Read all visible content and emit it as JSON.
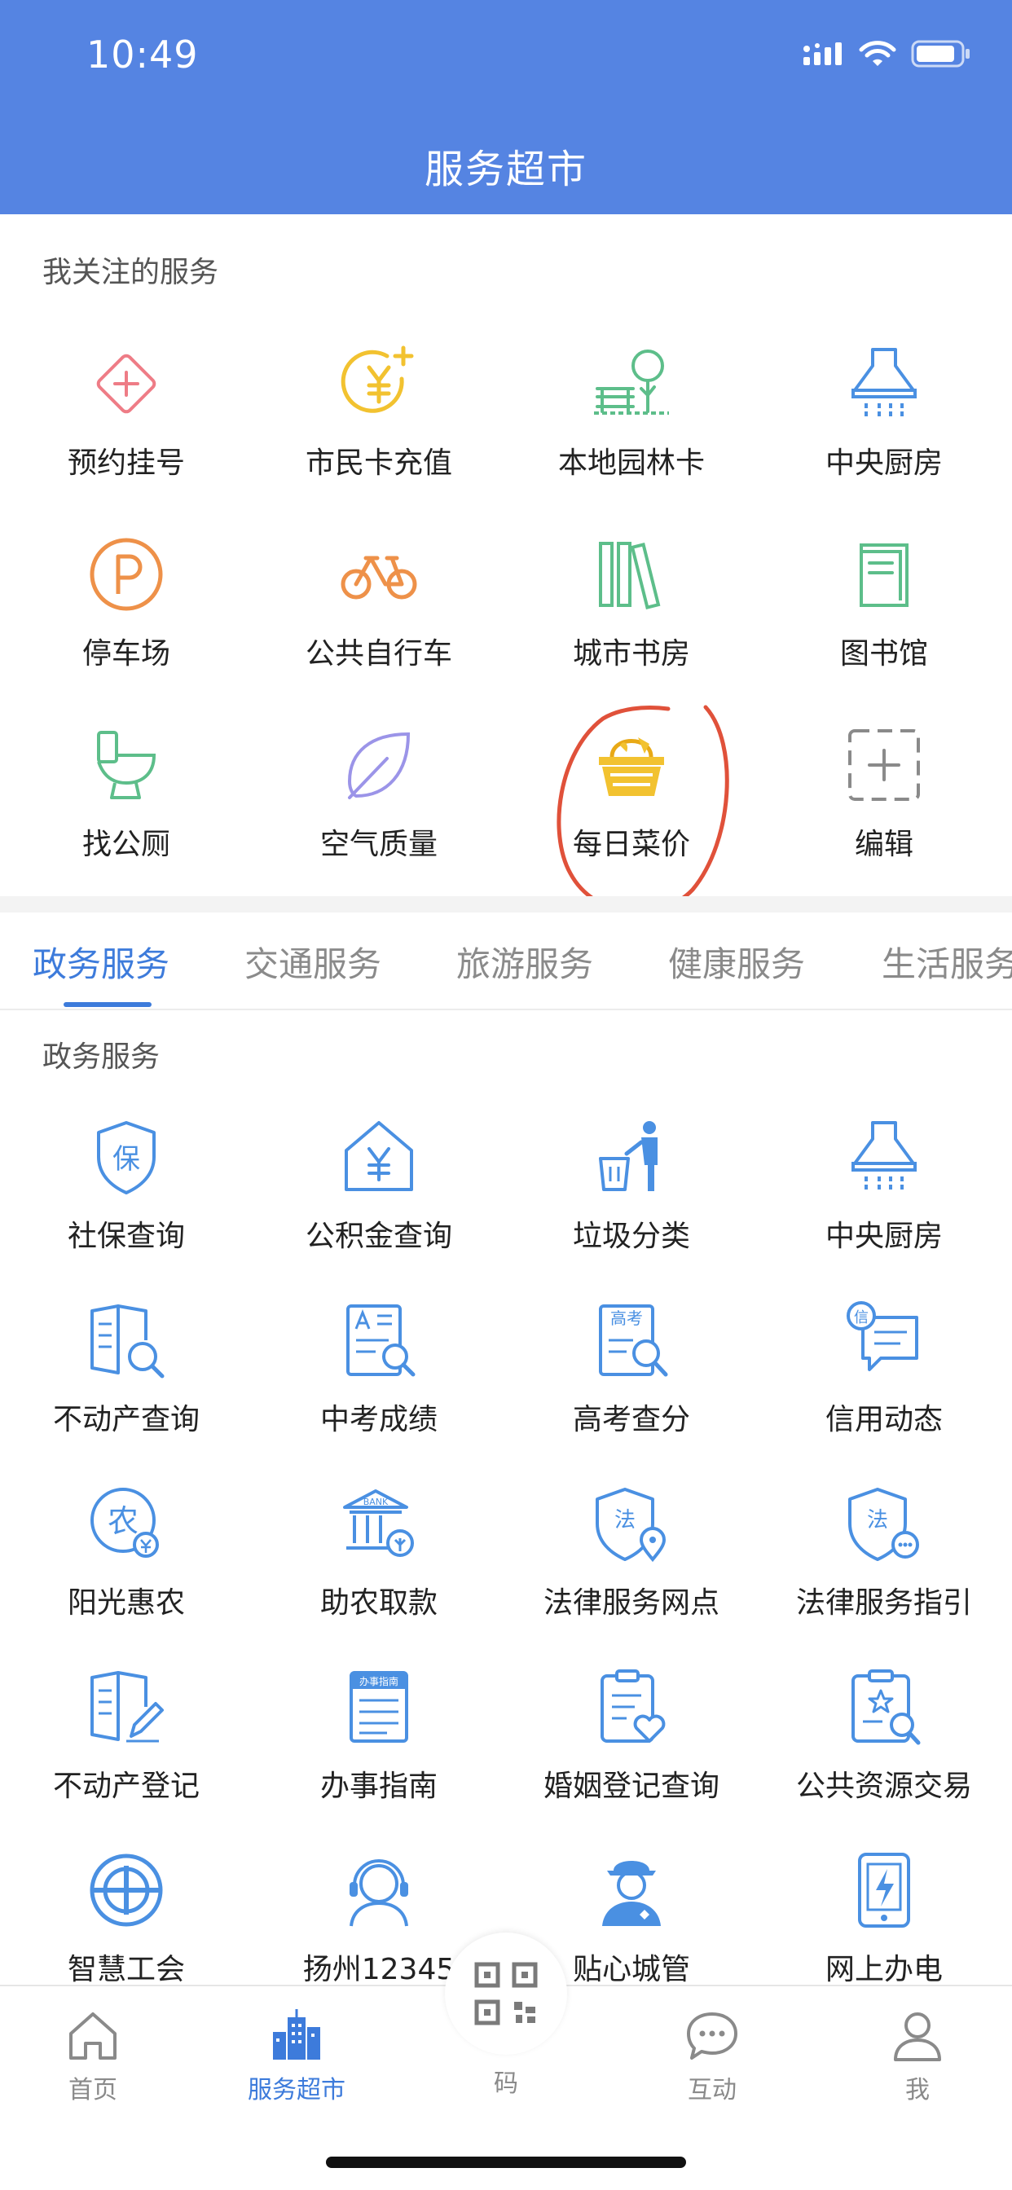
{
  "status_bar": {
    "time": "10:49"
  },
  "header": {
    "title": "服务超市"
  },
  "favorites": {
    "title": "我关注的服务",
    "items": [
      {
        "label": "预约挂号",
        "icon": "hospital-registration-icon"
      },
      {
        "label": "市民卡充值",
        "icon": "yuan-plus-icon"
      },
      {
        "label": "本地园林卡",
        "icon": "park-bench-icon"
      },
      {
        "label": "中央厨房",
        "icon": "range-hood-icon"
      },
      {
        "label": "停车场",
        "icon": "parking-icon"
      },
      {
        "label": "公共自行车",
        "icon": "bicycle-icon"
      },
      {
        "label": "城市书房",
        "icon": "bookshelf-icon"
      },
      {
        "label": "图书馆",
        "icon": "library-icon"
      },
      {
        "label": "找公厕",
        "icon": "toilet-icon"
      },
      {
        "label": "空气质量",
        "icon": "leaf-icon"
      },
      {
        "label": "每日菜价",
        "icon": "vegetable-basket-icon"
      },
      {
        "label": "编辑",
        "icon": "edit-add-icon"
      }
    ]
  },
  "tabs": [
    "政务服务",
    "交通服务",
    "旅游服务",
    "健康服务",
    "生活服务"
  ],
  "active_tab": "政务服务",
  "gov_services": {
    "title": "政务服务",
    "items": [
      {
        "label": "社保查询",
        "icon": "social-security-shield-icon"
      },
      {
        "label": "公积金查询",
        "icon": "housing-fund-icon"
      },
      {
        "label": "垃圾分类",
        "icon": "garbage-sorting-icon"
      },
      {
        "label": "中央厨房",
        "icon": "range-hood-icon"
      },
      {
        "label": "不动产查询",
        "icon": "property-search-icon"
      },
      {
        "label": "中考成绩",
        "icon": "exam-score-icon"
      },
      {
        "label": "高考查分",
        "icon": "gaokao-search-icon"
      },
      {
        "label": "信用动态",
        "icon": "credit-message-icon"
      },
      {
        "label": "阳光惠农",
        "icon": "agriculture-icon"
      },
      {
        "label": "助农取款",
        "icon": "bank-icon"
      },
      {
        "label": "法律服务网点",
        "icon": "law-location-icon"
      },
      {
        "label": "法律服务指引",
        "icon": "law-guide-icon"
      },
      {
        "label": "不动产登记",
        "icon": "property-register-icon"
      },
      {
        "label": "办事指南",
        "icon": "guide-book-icon"
      },
      {
        "label": "婚姻登记查询",
        "icon": "marriage-registry-icon"
      },
      {
        "label": "公共资源交易",
        "icon": "public-resource-icon"
      },
      {
        "label": "智慧工会",
        "icon": "trade-union-icon"
      },
      {
        "label": "扬州12345",
        "icon": "hotline-headset-icon"
      },
      {
        "label": "贴心城管",
        "icon": "city-officer-icon"
      },
      {
        "label": "网上办电",
        "icon": "electricity-icon"
      }
    ]
  },
  "bottom_nav": {
    "items": [
      {
        "label": "首页",
        "icon": "home-icon"
      },
      {
        "label": "服务超市",
        "icon": "buildings-icon"
      },
      {
        "label": "码",
        "icon": "qr-code-icon"
      },
      {
        "label": "互动",
        "icon": "chat-icon"
      },
      {
        "label": "我",
        "icon": "user-icon"
      }
    ]
  },
  "badge_texts": {
    "bank": "BANK",
    "guide": "办事指南",
    "gaokao": "高考",
    "credit": "信",
    "farm": "农",
    "law": "法",
    "insurance": "保"
  },
  "colors": {
    "header_blue": "#5584E2",
    "accent_blue": "#3D7BDB",
    "icon_blue": "#4A90E2",
    "annotation_red": "#E0513A"
  }
}
